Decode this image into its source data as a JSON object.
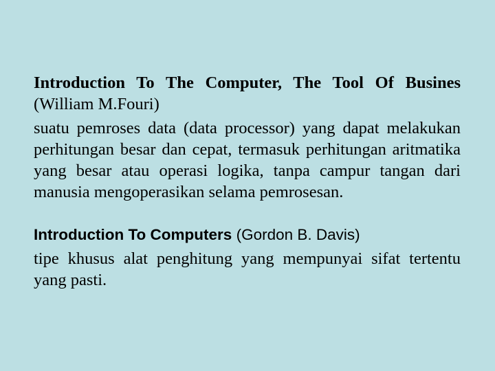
{
  "slide": {
    "background_color": "#bcdfe3",
    "definitions": [
      {
        "book_title": "Introduction To The Computer, The Tool Of Busines",
        "author": "(William M.Fouri)",
        "text": "suatu pemroses data (data processor) yang dapat melakukan perhitungan besar dan cepat, termasuk perhitungan aritmatika yang besar atau operasi logika, tanpa campur tangan dari manusia mengoperasikan selama pemrosesan."
      },
      {
        "book_title": "Introduction To Computers",
        "author": "(Gordon B. Davis)",
        "text": "tipe khusus alat penghitung yang mempunyai sifat tertentu yang pasti."
      }
    ]
  }
}
